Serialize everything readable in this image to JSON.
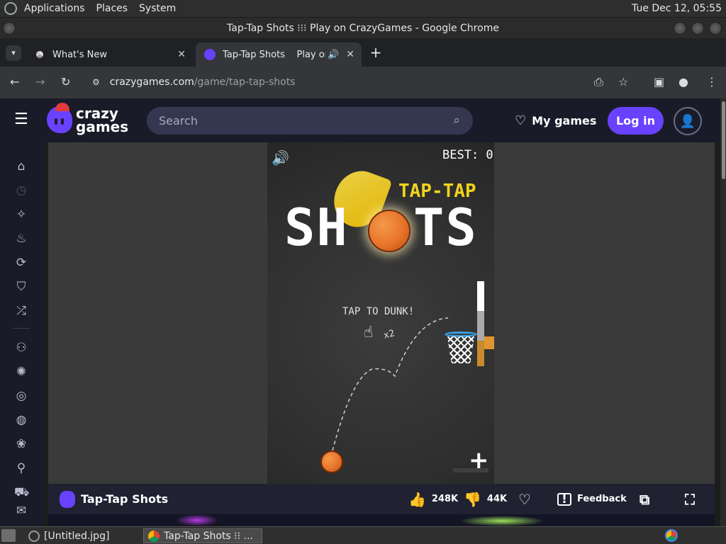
{
  "os": {
    "menu": [
      "Applications",
      "Places",
      "System"
    ],
    "clock": "Tue Dec 12, 05:55"
  },
  "window": {
    "title": "Tap-Tap Shots ⁝⁝⁝ Play on CrazyGames - Google Chrome"
  },
  "tabs": [
    {
      "label": "What's New",
      "active": false
    },
    {
      "label": "Tap-Tap Shots    Play on C",
      "active": true
    }
  ],
  "address": {
    "host": "crazygames.com",
    "path": "/game/tap-tap-shots"
  },
  "site": {
    "logo_line1": "crazy",
    "logo_line2": "games",
    "search_placeholder": "Search",
    "my_games": "My games",
    "login": "Log in"
  },
  "sidebar": {
    "icons": [
      "home-icon",
      "recent-icon",
      "sparkle-icon",
      "flame-icon",
      "refresh-icon",
      "badge-icon",
      "shuffle-icon",
      "multiplayer-icon",
      "action-icon",
      "compass-icon",
      "basketball-icon",
      "flower-icon",
      "bike-icon",
      "car-icon",
      "mail-icon"
    ]
  },
  "game": {
    "best_label": "BEST: 0",
    "title_small": "TAP-TAP",
    "title_big_left": "SH",
    "title_big_right": "TS",
    "tap_text": "TAP TO DUNK!",
    "x2": "x2",
    "plus": "+"
  },
  "gamebar": {
    "name": "Tap-Tap Shots",
    "likes": "248K",
    "dislikes": "44K",
    "feedback": "Feedback"
  },
  "taskbar": {
    "items": [
      "[Untitled.jpg]",
      "Tap-Tap Shots ⁝⁝ ..."
    ]
  },
  "colors": {
    "accent": "#6842ff",
    "header_bg": "#1a1b28",
    "ball_orange": "#e8742a"
  }
}
